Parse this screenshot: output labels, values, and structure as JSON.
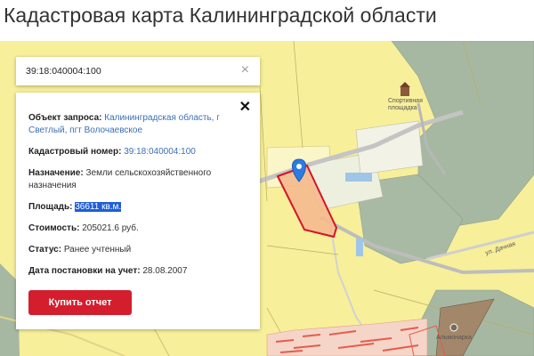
{
  "page": {
    "title": "Кадастровая карта Калининградской области"
  },
  "search": {
    "value": "39:18:040004:100",
    "clear_glyph": "×"
  },
  "info": {
    "close_glyph": "✕",
    "request_label": "Объект запроса:",
    "request_value": "Калининградская область, г Светлый, пгт Волочаевское",
    "cadastral_label": "Кадастровый номер:",
    "cadastral_value": "39:18:040004:100",
    "purpose_label": "Назначение:",
    "purpose_value": "Земли сельскохозяйственного назначения",
    "area_label": "Площадь:",
    "area_value": "36611 кв.м.",
    "cost_label": "Стоимость:",
    "cost_value": "205021.6 руб.",
    "status_label": "Статус:",
    "status_value": "Ранее учтенный",
    "date_label": "Дата постановки на учет:",
    "date_value": "28.08.2007",
    "buy_button": "Купить отчет"
  },
  "map": {
    "labels": {
      "sport": "Спортивная площадка",
      "road": "ул. Дачная",
      "poi": "Альмонарка"
    }
  },
  "colors": {
    "accent_red": "#d41e2e",
    "link_blue": "#3b6fb6",
    "selection_blue": "#1e5fd6",
    "map_yellow": "#f7ef9a",
    "map_green": "#a7b8a2",
    "parcel_fill": "#f4b98e",
    "parcel_stroke": "#d5142a"
  },
  "icons": {
    "clear": "close-icon",
    "close": "close-icon",
    "marker": "map-marker-icon",
    "building": "building-icon"
  }
}
